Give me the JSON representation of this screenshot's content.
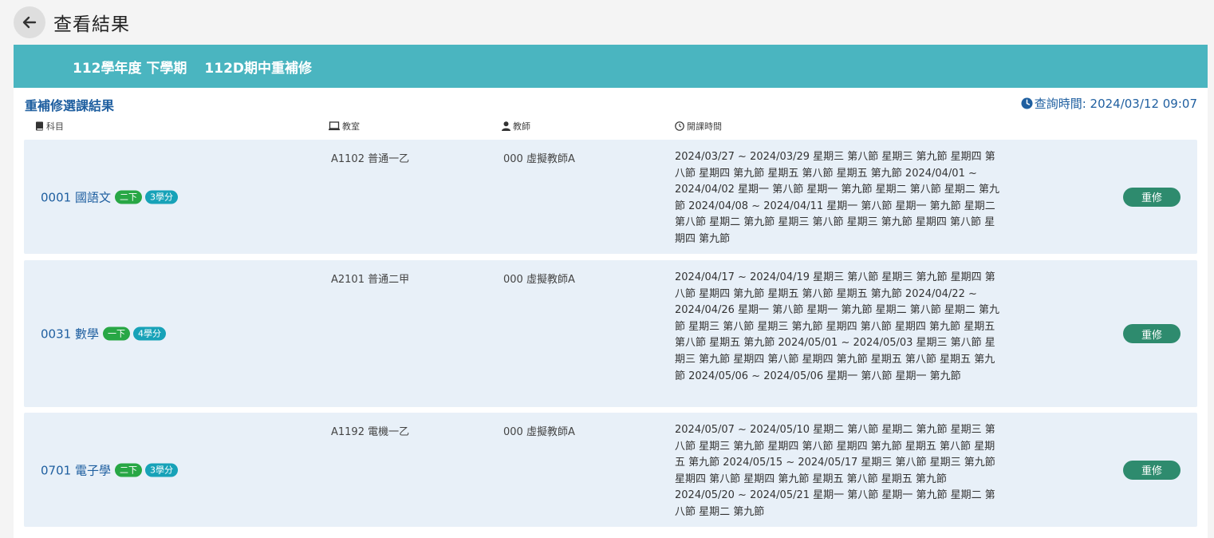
{
  "header": {
    "title": "查看結果"
  },
  "banner": {
    "term": "112學年度 下學期",
    "session": "112D期中重補修"
  },
  "section": {
    "title": "重補修選課結果",
    "query_time": "查詢時間: 2024/03/12 09:07"
  },
  "columns": {
    "subject": "科目",
    "classroom": "教室",
    "teacher": "教師",
    "schedule": "開課時間"
  },
  "courses": [
    {
      "code_name": "0001 國語文",
      "grade": "二下",
      "credits": "3學分",
      "classroom": "A1102 普通一乙",
      "teacher": "000 虛擬教師A",
      "schedule": "2024/03/27 ~ 2024/03/29  星期三 第八節 星期三 第九節 星期四 第八節 星期四 第九節 星期五 第八節 星期五 第九節 2024/04/01 ~ 2024/04/02  星期一 第八節 星期一 第九節 星期二 第八節 星期二 第九節 2024/04/08 ~ 2024/04/11  星期一 第八節 星期一 第九節 星期二 第八節 星期二 第九節 星期三 第八節 星期三 第九節 星期四 第八節 星期四 第九節",
      "action": "重修"
    },
    {
      "code_name": "0031 數學",
      "grade": "一下",
      "credits": "4學分",
      "classroom": "A2101 普通二甲",
      "teacher": "000 虛擬教師A",
      "schedule": "2024/04/17 ~ 2024/04/19  星期三 第八節 星期三 第九節 星期四 第八節 星期四 第九節 星期五 第八節 星期五 第九節 2024/04/22 ~ 2024/04/26  星期一 第八節 星期一 第九節 星期二 第八節 星期二 第九節 星期三 第八節 星期三 第九節 星期四 第八節 星期四 第九節 星期五 第八節 星期五 第九節 2024/05/01 ~ 2024/05/03  星期三 第八節 星期三 第九節 星期四 第八節 星期四 第九節 星期五 第八節 星期五 第九節 2024/05/06 ~ 2024/05/06  星期一 第八節 星期一 第九節",
      "action": "重修"
    },
    {
      "code_name": "0701 電子學",
      "grade": "二下",
      "credits": "3學分",
      "classroom": "A1192 電機一乙",
      "teacher": "000 虛擬教師A",
      "schedule": "2024/05/07 ~ 2024/05/10  星期二 第八節 星期二 第九節 星期三 第八節 星期三 第九節 星期四 第八節 星期四 第九節 星期五 第八節 星期五 第九節 2024/05/15 ~ 2024/05/17  星期三 第八節 星期三 第九節 星期四 第八節 星期四 第九節 星期五 第八節 星期五 第九節 2024/05/20 ~ 2024/05/21  星期一 第八節 星期一 第九節 星期二 第八節 星期二 第九節",
      "action": "重修"
    }
  ],
  "colors": {
    "banner": "#4ab5c0",
    "link": "#1f5fa0",
    "grade_badge": "#28a745",
    "credit_badge": "#17a2b8",
    "retake_button": "#2e8b6e",
    "row_bg": "#e8f0f8"
  },
  "icons": {
    "back": "arrow-left-icon",
    "subject": "book-icon",
    "classroom": "monitor-icon",
    "teacher": "user-icon",
    "schedule": "clock-icon"
  }
}
